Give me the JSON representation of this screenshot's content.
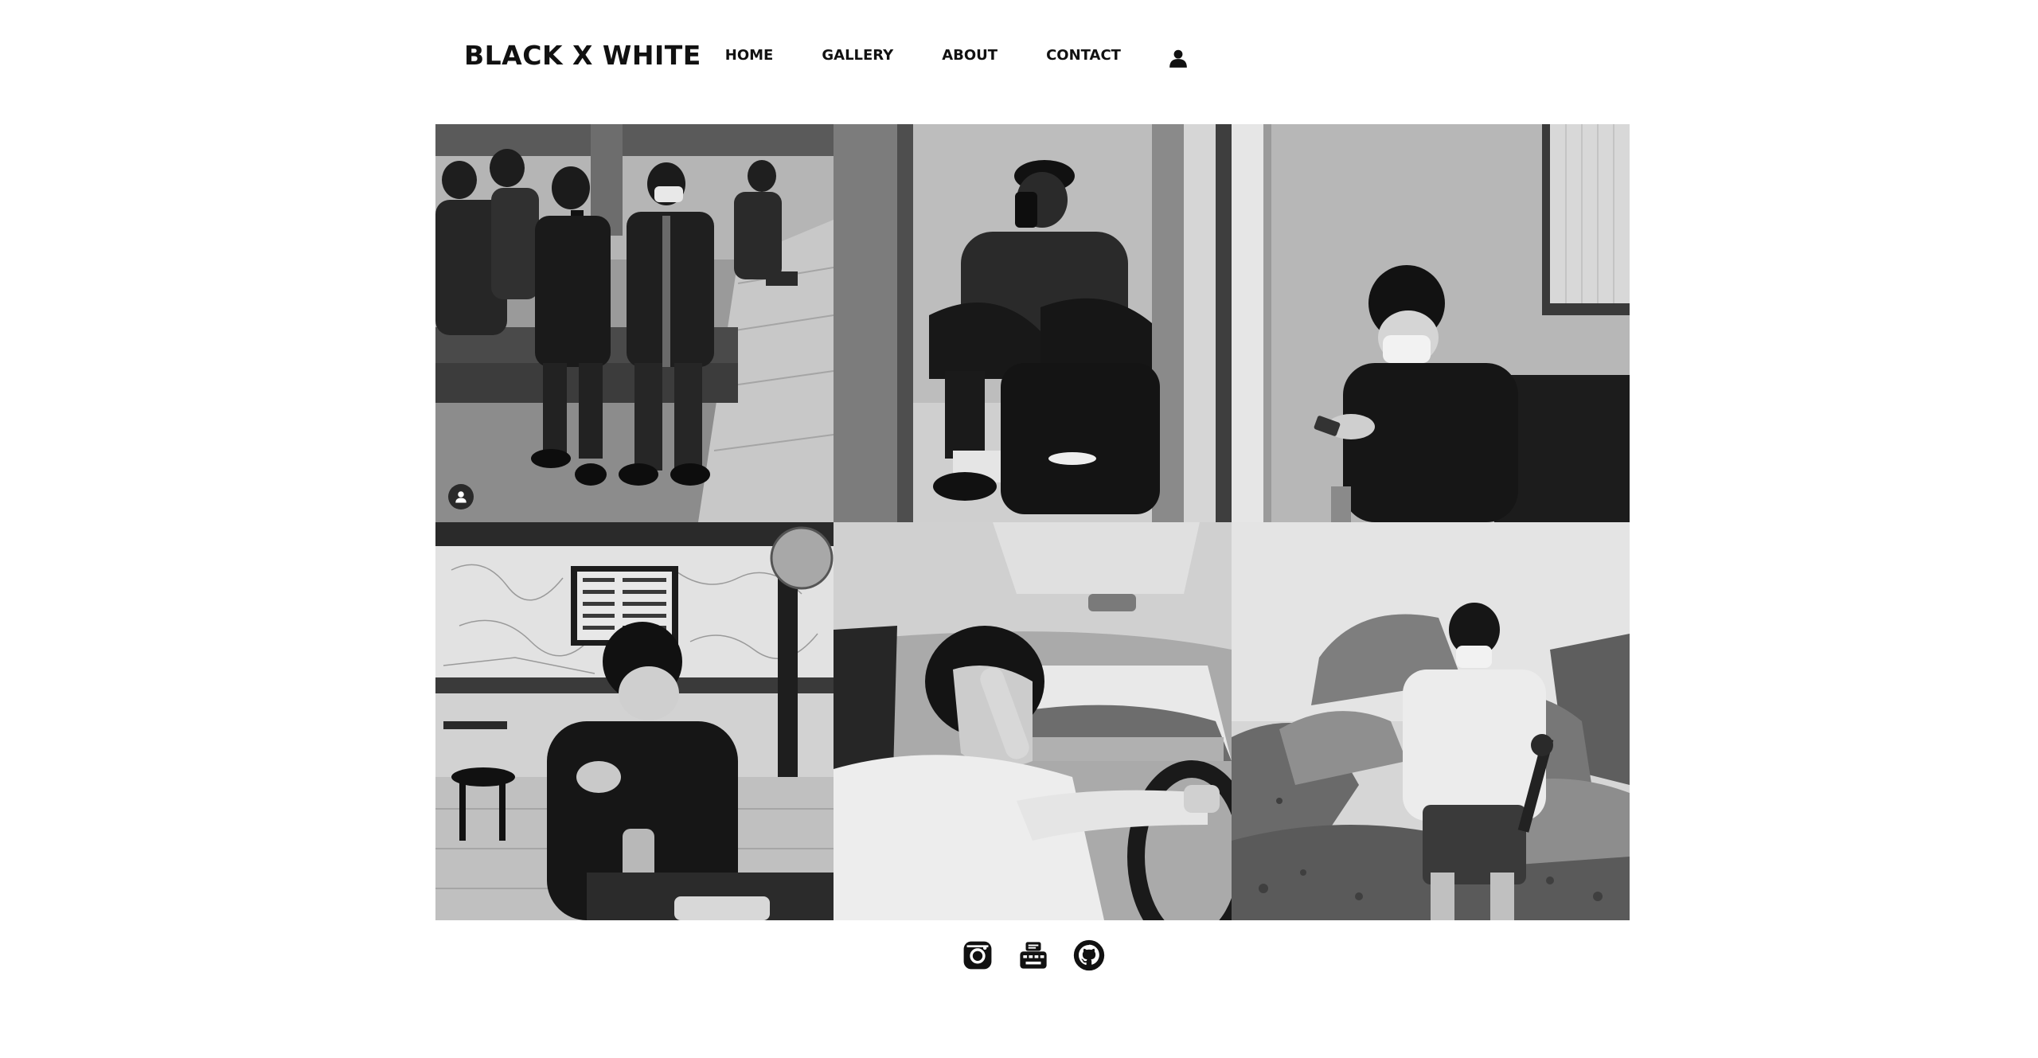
{
  "header": {
    "brand": "BLACK X WHITE",
    "nav": [
      {
        "label": "HOME"
      },
      {
        "label": "GALLERY"
      },
      {
        "label": "ABOUT"
      },
      {
        "label": "CONTACT"
      }
    ],
    "user_icon": "user-icon"
  },
  "gallery": {
    "photos": [
      {
        "icon": "photo-group-street"
      },
      {
        "icon": "photo-mirror-selfie"
      },
      {
        "icon": "photo-phone-window"
      },
      {
        "icon": "photo-restaurant"
      },
      {
        "icon": "photo-driving"
      },
      {
        "icon": "photo-rocks"
      }
    ],
    "avatar_icon": "user-avatar-icon"
  },
  "footer": {
    "social": [
      {
        "icon": "instagram-icon"
      },
      {
        "icon": "blog-icon"
      },
      {
        "icon": "github-icon"
      }
    ]
  },
  "colors": {
    "text": "#111111",
    "background": "#ffffff"
  }
}
